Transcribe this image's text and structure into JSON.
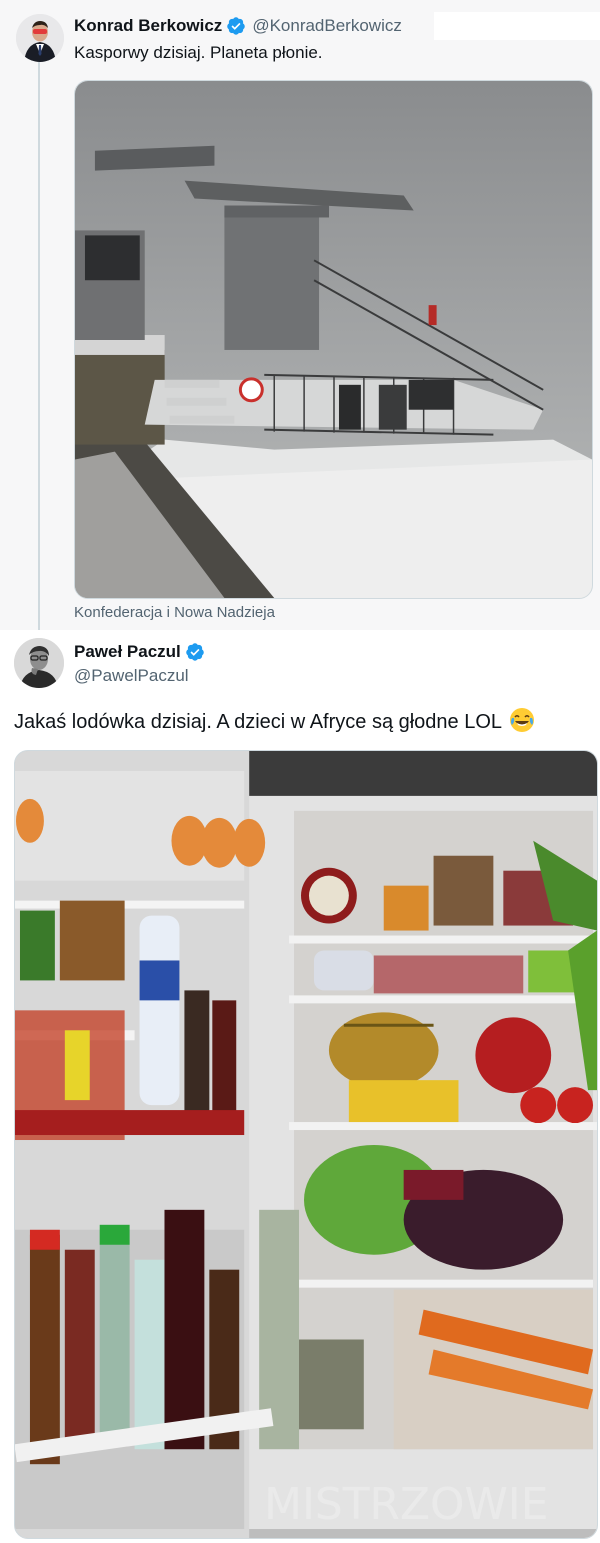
{
  "quoted_tweet": {
    "author": {
      "display_name": "Konrad Berkowicz",
      "handle": "@KonradBerkowicz",
      "verified": true,
      "avatar_icon": "avatar-icon"
    },
    "text": "Kasporwy dzisiaj. Planeta płonie.",
    "media": {
      "description_icon": "snowy-ski-lift-station-image"
    },
    "caption": "Konfederacja i Nowa Nadzieja"
  },
  "main_tweet": {
    "author": {
      "display_name": "Paweł Paczul",
      "handle": "@PawelPaczul",
      "verified": true,
      "avatar_icon": "avatar-icon"
    },
    "text": "Jakaś lodówka dzisiaj. A dzieci w Afryce są głodne LOL",
    "emoji_icon": "laughing-crying-emoji",
    "media": {
      "description_icon": "full-fridge-image"
    }
  },
  "watermark": "MISTRZOWIE",
  "colors": {
    "verified": "#1d9bf0",
    "text": "#0f1419",
    "secondary": "#536471",
    "quote_bg": "#f7f7f8"
  }
}
